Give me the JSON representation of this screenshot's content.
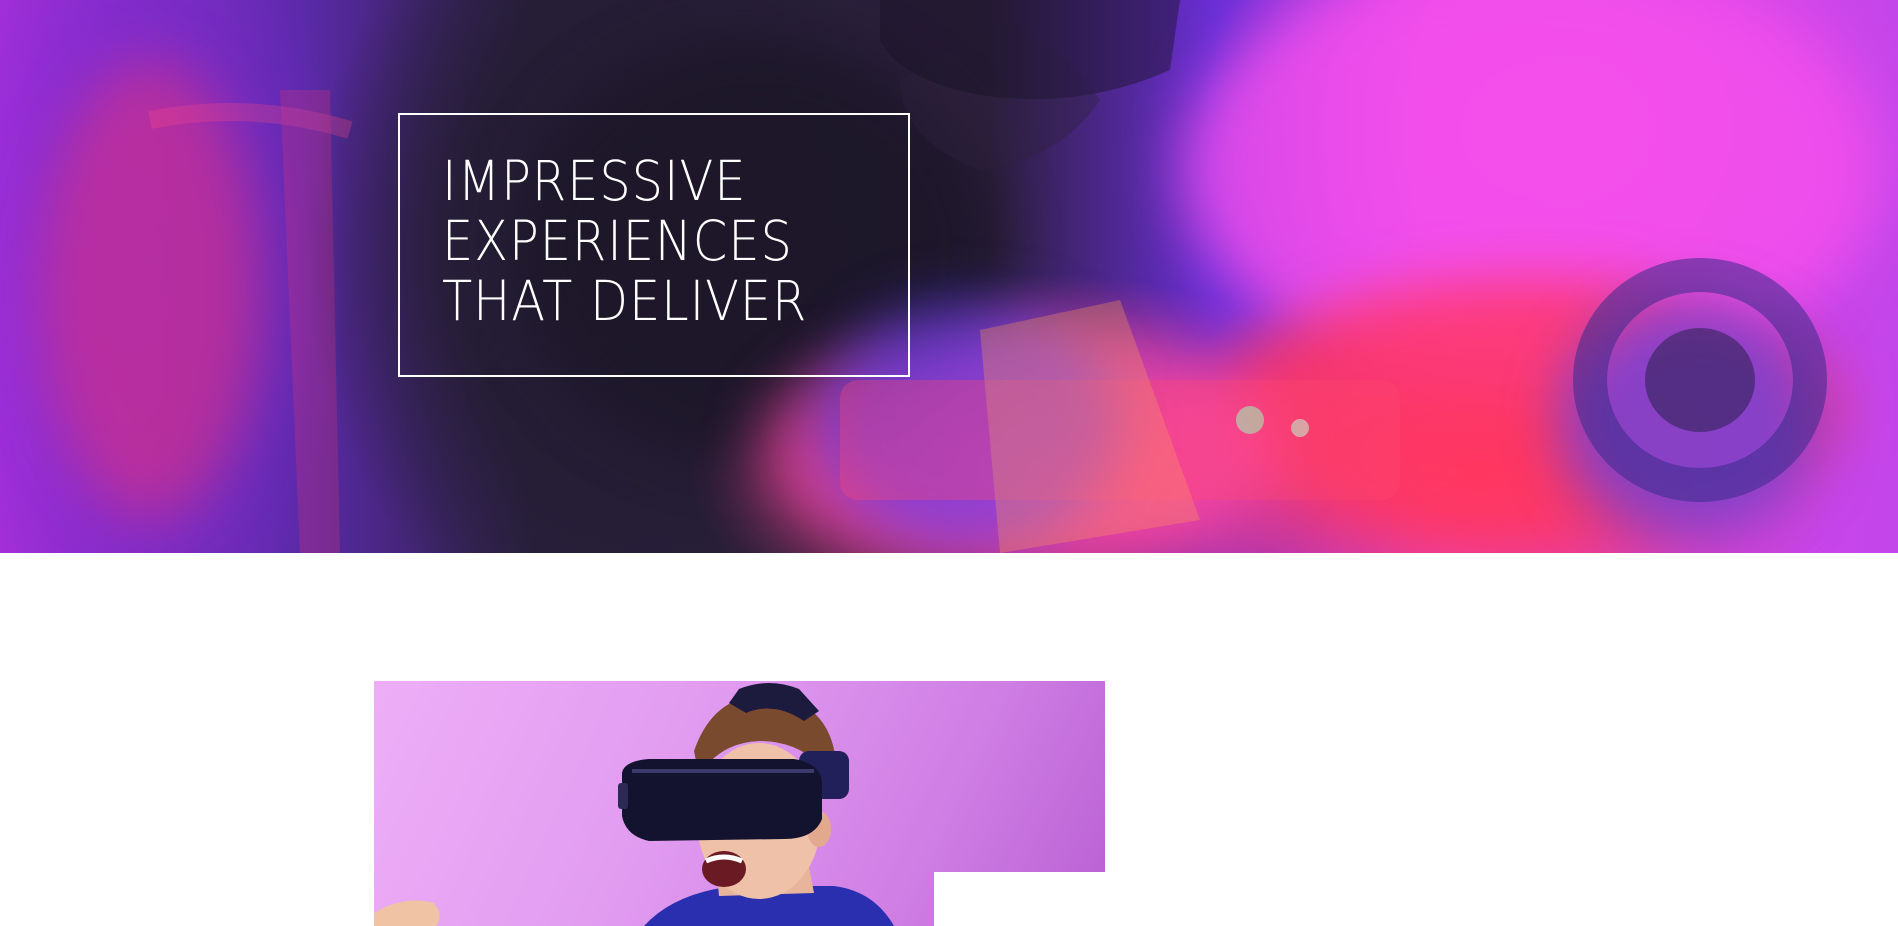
{
  "hero": {
    "headline_lines": [
      "IMPRESSIVE",
      "EXPERIENCES",
      "THAT DELIVER"
    ],
    "background_colors": {
      "magenta": "#f44de6",
      "violet": "#7b2bd6",
      "dark": "#241d33",
      "red": "#ff3a5c",
      "blue": "#3c46ff"
    },
    "background_image": "neon-tinted-dj-photo"
  },
  "feature": {
    "image": "vr-headset-person-photo",
    "background_colors": {
      "light": "#eeaef7",
      "deep": "#b95fd4"
    }
  }
}
